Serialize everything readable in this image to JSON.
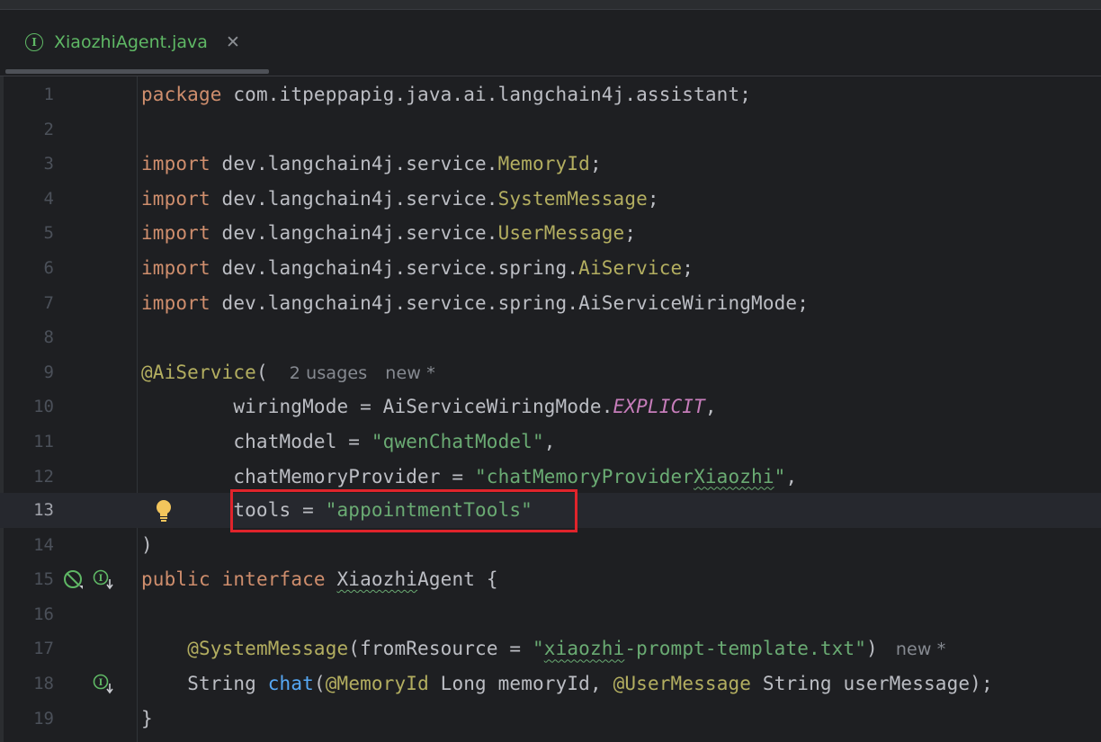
{
  "tab": {
    "icon": "I",
    "title": "XiaozhiAgent.java",
    "close": "✕"
  },
  "editor": {
    "line_numbers": [
      "1",
      "2",
      "3",
      "4",
      "5",
      "6",
      "7",
      "8",
      "9",
      "10",
      "11",
      "12",
      "13",
      "14",
      "15",
      "16",
      "17",
      "18",
      "19"
    ],
    "current_line": "13",
    "lines": {
      "l1": {
        "kw": "package",
        "rest": " com.itpeppapig.java.ai.langchain4j.assistant;"
      },
      "l3": {
        "kw": "import",
        "pre": " dev.langchain4j.service.",
        "cls": "MemoryId",
        "end": ";"
      },
      "l4": {
        "kw": "import",
        "pre": " dev.langchain4j.service.",
        "cls": "SystemMessage",
        "end": ";"
      },
      "l5": {
        "kw": "import",
        "pre": " dev.langchain4j.service.",
        "cls": "UserMessage",
        "end": ";"
      },
      "l6": {
        "kw": "import",
        "pre": " dev.langchain4j.service.spring.",
        "cls": "AiService",
        "end": ";"
      },
      "l7": {
        "kw": "import",
        "rest": " dev.langchain4j.service.spring.AiServiceWiringMode;"
      },
      "l9": {
        "ann": "@AiService",
        "paren": "(",
        "usages": "2 usages",
        "new": "new *"
      },
      "l10": {
        "pre": "        wiringMode = AiServiceWiringMode.",
        "const": "EXPLICIT",
        "end": ","
      },
      "l11": {
        "pre": "        chatModel = ",
        "str": "\"qwenChatModel\"",
        "end": ","
      },
      "l12": {
        "pre": "        chatMemoryProvider = ",
        "str1": "\"chatMemoryProvider",
        "str2": "Xiaozhi",
        "str3": "\"",
        "end": ","
      },
      "l13": {
        "pre": "        tools = ",
        "str": "\"appointmentTools\""
      },
      "l14": {
        "text": ")"
      },
      "l15": {
        "kw1": "public",
        "kw2": "interface",
        "name1": "Xiaozhi",
        "name2": "Agent",
        "end": " {"
      },
      "l17": {
        "ann": "@SystemMessage",
        "pre": "(fromResource = ",
        "q": "\"",
        "str": "xiaozhi",
        "str2": "-prompt-template.txt",
        "q2": "\"",
        "end": ")",
        "new": "new *"
      },
      "l18": {
        "type": "String ",
        "fn": "chat",
        "p1": "(",
        "ann1": "@MemoryId",
        "mid": " Long memoryId, ",
        "ann2": "@UserMessage",
        "end": " String userMessage);"
      },
      "l19": {
        "text": "}"
      }
    }
  },
  "colors": {
    "background": "#1e1f22",
    "keyword": "#cf8e6d",
    "annotation": "#b3ae60",
    "string": "#6aab73",
    "constant": "#c77dbb",
    "method": "#56a8f5",
    "highlight_box": "#e0242b"
  },
  "icons": {
    "bulb": "lightbulb-icon",
    "no_icon": "no-symbol-icon",
    "impl": "implemented-interface-icon"
  }
}
